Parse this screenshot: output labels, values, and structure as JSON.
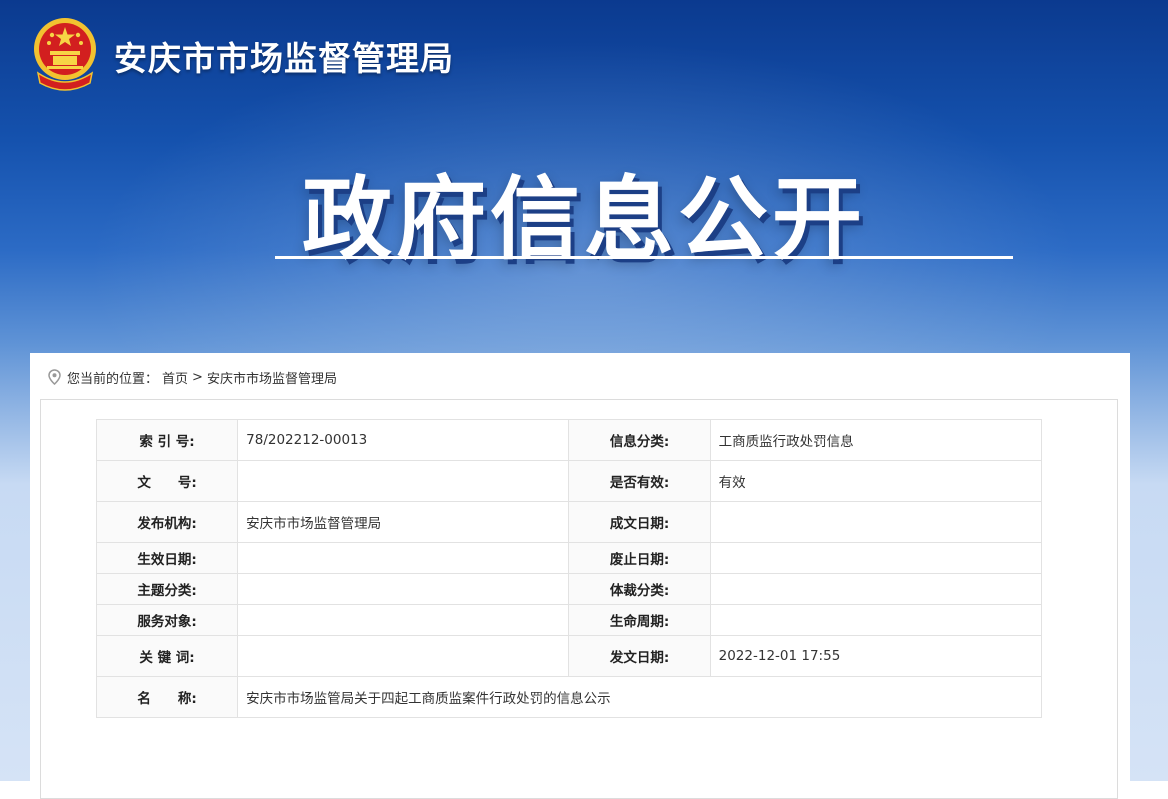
{
  "site": {
    "title": "安庆市市场监督管理局"
  },
  "hero": {
    "title": "政府信息公开"
  },
  "breadcrumb": {
    "prefix": "您当前的位置：",
    "home": "首页",
    "sep": ">",
    "current": "安庆市市场监督管理局"
  },
  "meta": {
    "index_label": "索 引 号:",
    "index_value": "78/202212-00013",
    "category_label": "信息分类:",
    "category_value": "工商质监行政处罚信息",
    "docno_label": "文　　号:",
    "docno_value": "",
    "valid_label": "是否有效:",
    "valid_value": "有效",
    "publisher_label": "发布机构:",
    "publisher_value": "安庆市市场监督管理局",
    "written_label": "成文日期:",
    "written_value": "",
    "effective_label": "生效日期:",
    "effective_value": "",
    "repeal_label": "废止日期:",
    "repeal_value": "",
    "topic_label": "主题分类:",
    "topic_value": "",
    "genre_label": "体裁分类:",
    "genre_value": "",
    "audience_label": "服务对象:",
    "audience_value": "",
    "lifecycle_label": "生命周期:",
    "lifecycle_value": "",
    "keywords_label": "关 键 词:",
    "keywords_value": "",
    "pubdate_label": "发文日期:",
    "pubdate_value": "2022-12-01 17:55",
    "name_label": "名　　称:",
    "name_value": "安庆市市场监管局关于四起工商质监案件行政处罚的信息公示"
  },
  "colors": {
    "banner_top": "#0b3a8f",
    "emblem_red": "#d21f1f",
    "emblem_gold": "#f2c230"
  }
}
